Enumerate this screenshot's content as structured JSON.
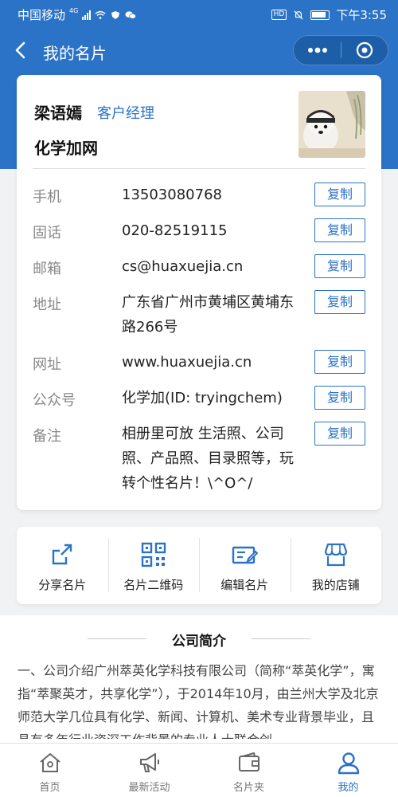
{
  "status_bar": {
    "carrier": "中国移动",
    "network": "4G",
    "hd": "HD",
    "time": "下午3:55"
  },
  "nav": {
    "title": "我的名片",
    "back_icon": "chevron-left-icon",
    "more_icon": "more-dots-icon",
    "close_icon": "target-circle-icon"
  },
  "card": {
    "name": "梁语嫣",
    "position": "客户经理",
    "company": "化学加网",
    "rows": [
      {
        "label": "手机",
        "value": "13503080768",
        "copy": "复制"
      },
      {
        "label": "固话",
        "value": "020-82519115",
        "copy": "复制"
      },
      {
        "label": "邮箱",
        "value": "cs@huaxuejia.cn",
        "copy": "复制"
      },
      {
        "label": "地址",
        "value": "广东省广州市黄埔区黄埔东路266号",
        "copy": "复制"
      },
      {
        "label": "网址",
        "value": "www.huaxuejia.cn",
        "copy": "复制"
      },
      {
        "label": "公众号",
        "value": "化学加(ID: tryingchem)",
        "copy": "复制"
      },
      {
        "label": "备注",
        "value": "相册里可放 生活照、公司照、产品照、目录照等，玩转个性名片！\\^O^/",
        "copy": "复制"
      }
    ]
  },
  "actions": [
    {
      "label": "分享名片",
      "icon": "share-icon"
    },
    {
      "label": "名片二维码",
      "icon": "qr-code-icon"
    },
    {
      "label": "编辑名片",
      "icon": "edit-card-icon"
    },
    {
      "label": "我的店铺",
      "icon": "store-icon"
    }
  ],
  "intro": {
    "title": "公司简介",
    "text": "一、公司介绍广州萃英化学科技有限公司（简称“萃英化学”，寓指“萃聚英才，共享化学”），于2014年10月，由兰州大学及北京师范大学几位具有化学、新闻、计算机、美术专业背景毕业，且具有多年行业资深工作背景的专业人士联合创"
  },
  "tabbar": [
    {
      "label": "首页",
      "icon": "home-icon"
    },
    {
      "label": "最新活动",
      "icon": "megaphone-icon"
    },
    {
      "label": "名片夹",
      "icon": "wallet-icon"
    },
    {
      "label": "我的",
      "icon": "user-icon"
    }
  ],
  "colors": {
    "primary": "#2b73c6",
    "background": "#f1f2f4"
  }
}
